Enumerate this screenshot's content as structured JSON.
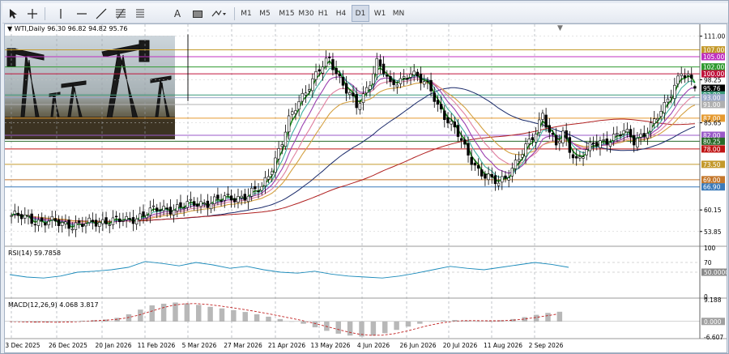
{
  "toolbar": {
    "tools": [
      {
        "name": "cursor-icon"
      },
      {
        "name": "crosshair-icon"
      },
      {
        "name": "vertical-line-icon"
      },
      {
        "name": "horizontal-line-icon"
      },
      {
        "name": "trendline-icon"
      },
      {
        "name": "fibonacci-icon"
      },
      {
        "name": "text-icon",
        "label": "A"
      },
      {
        "name": "text-label-icon",
        "label": "T"
      },
      {
        "name": "rectangle-icon"
      },
      {
        "name": "shapes-dropdown-icon"
      }
    ],
    "timeframes": [
      "M1",
      "M5",
      "M15",
      "M30",
      "H1",
      "H4",
      "D1",
      "W1",
      "MN"
    ],
    "active_timeframe": "D1"
  },
  "chart": {
    "symbol_info": "WTI,Daily  96.30 96.82 94.82 95.76",
    "price_labels": [
      {
        "text": "111.00",
        "value": 111.0,
        "bg": ""
      },
      {
        "text": "107.00",
        "value": 107.0,
        "bg": "#c49a2c"
      },
      {
        "text": "105.00",
        "value": 105.0,
        "bg": "#c030c0"
      },
      {
        "text": "102.00",
        "value": 102.0,
        "bg": "#2f9a2f"
      },
      {
        "text": "100.00",
        "value": 100.0,
        "bg": "#c0143c"
      },
      {
        "text": "98.25",
        "value": 98.25,
        "bg": ""
      },
      {
        "text": "95.76",
        "value": 95.76,
        "bg": "#000000"
      },
      {
        "text": "93.80",
        "value": 93.8,
        "bg": "#3a9a7a"
      },
      {
        "text": "93.00",
        "value": 93.0,
        "bg": "#9aa8c8"
      },
      {
        "text": "91.00",
        "value": 91.0,
        "bg": "#b0b0b0"
      },
      {
        "text": "87.00",
        "value": 87.0,
        "bg": "#e59a30"
      },
      {
        "text": "85.65",
        "value": 85.65,
        "bg": ""
      },
      {
        "text": "82.00",
        "value": 82.0,
        "bg": "#9a5ac8"
      },
      {
        "text": "80.25",
        "value": 80.25,
        "bg": "#2a6a2a"
      },
      {
        "text": "78.00",
        "value": 78.0,
        "bg": "#c01414"
      },
      {
        "text": "73.50",
        "value": 73.5,
        "bg": "#c49a2c"
      },
      {
        "text": "69.00",
        "value": 69.0,
        "bg": "#c4782c"
      },
      {
        "text": "66.90",
        "value": 66.9,
        "bg": "#3a7aba"
      },
      {
        "text": "60.15",
        "value": 60.15,
        "bg": ""
      },
      {
        "text": "53.85",
        "value": 53.85,
        "bg": ""
      }
    ],
    "date_labels": [
      "3 Dec 2025",
      "26 Dec 2025",
      "20 Jan 2026",
      "11 Feb 2026",
      "5 Mar 2026",
      "27 Mar 2026",
      "21 Apr 2026",
      "13 May 2026",
      "4 Jun 2026",
      "26 Jun 2026",
      "20 Jul 2026",
      "11 Aug 2026",
      "2 Sep 2026"
    ]
  },
  "rsi": {
    "label": "RSI(14) 59.7858",
    "levels": [
      {
        "text": "100",
        "value": 100
      },
      {
        "text": "70",
        "value": 70
      },
      {
        "text": "50.0000",
        "value": 50,
        "highlight": true
      },
      {
        "text": "0",
        "value": 0
      }
    ]
  },
  "macd": {
    "label": "MACD(12,26,9) 4.068 3.817",
    "levels": [
      {
        "text": "9.188",
        "value": 9.188
      },
      {
        "text": "0.000",
        "value": 0,
        "highlight": true
      },
      {
        "text": "-6.607",
        "value": -6.607
      }
    ]
  },
  "chart_data": {
    "type": "candlestick",
    "title": "WTI,Daily",
    "x_dates": [
      "3 Dec 2025",
      "26 Dec 2025",
      "20 Jan 2026",
      "11 Feb 2026",
      "5 Mar 2026",
      "27 Mar 2026",
      "21 Apr 2026",
      "13 May 2026",
      "4 Jun 2026",
      "26 Jun 2026",
      "20 Jul 2026",
      "11 Aug 2026",
      "2 Sep 2026"
    ],
    "ylim": [
      50,
      114
    ],
    "last": {
      "open": 96.3,
      "high": 96.82,
      "low": 94.82,
      "close": 95.76
    },
    "close_path": [
      [
        0,
        58.5
      ],
      [
        8,
        57
      ],
      [
        14,
        56.2
      ],
      [
        22,
        55.8
      ],
      [
        28,
        57.2
      ],
      [
        34,
        56.8
      ],
      [
        40,
        59.5
      ],
      [
        46,
        60.5
      ],
      [
        52,
        61.5
      ],
      [
        58,
        62.5
      ],
      [
        64,
        63.5
      ],
      [
        70,
        64.5
      ],
      [
        74,
        66.5
      ],
      [
        77,
        73
      ],
      [
        80,
        80
      ],
      [
        82,
        86
      ],
      [
        85,
        92
      ],
      [
        88,
        97
      ],
      [
        91,
        101
      ],
      [
        94,
        104
      ],
      [
        97,
        99
      ],
      [
        100,
        94
      ],
      [
        102,
        90
      ],
      [
        104,
        93
      ],
      [
        106,
        98
      ],
      [
        108,
        104
      ],
      [
        110,
        101
      ],
      [
        112,
        96
      ],
      [
        115,
        98
      ],
      [
        118,
        101
      ],
      [
        121,
        98
      ],
      [
        124,
        95
      ],
      [
        126,
        91
      ],
      [
        128,
        88
      ],
      [
        130,
        85
      ],
      [
        132,
        82
      ],
      [
        134,
        78
      ],
      [
        136,
        75
      ],
      [
        138,
        72
      ],
      [
        140,
        70
      ],
      [
        142,
        68.5
      ],
      [
        144,
        68
      ],
      [
        146,
        70
      ],
      [
        149,
        74
      ],
      [
        152,
        78
      ],
      [
        155,
        83
      ],
      [
        157,
        89
      ],
      [
        159,
        83
      ],
      [
        161,
        79
      ],
      [
        163,
        82
      ],
      [
        165,
        78
      ],
      [
        167,
        75
      ],
      [
        169,
        77
      ],
      [
        172,
        79
      ],
      [
        175,
        80
      ],
      [
        178,
        82
      ],
      [
        181,
        83
      ],
      [
        184,
        80
      ],
      [
        187,
        83
      ],
      [
        190,
        86
      ],
      [
        193,
        90
      ],
      [
        196,
        97
      ],
      [
        198,
        101
      ],
      [
        200,
        99
      ],
      [
        202,
        95.76
      ]
    ],
    "ema_series": [
      {
        "color": "#1a8a1a",
        "lag": 3
      },
      {
        "color": "#40b0a0",
        "lag": 6
      },
      {
        "color": "#9a40b0",
        "lag": 10
      },
      {
        "color": "#e080a0",
        "lag": 16
      },
      {
        "color": "#d4a040",
        "lag": 24
      }
    ],
    "sma_series": [
      {
        "color": "#1a2a6a",
        "lag": 50
      },
      {
        "color": "#b02020",
        "lag": 100
      }
    ],
    "rsi_series": [
      45,
      40,
      38,
      42,
      50,
      52,
      55,
      60,
      72,
      68,
      63,
      70,
      65,
      58,
      62,
      55,
      50,
      48,
      52,
      46,
      42,
      40,
      38,
      42,
      48,
      55,
      62,
      58,
      55,
      60,
      65,
      70,
      66,
      60
    ],
    "macd_hist": [
      0,
      -0.3,
      -0.5,
      -0.4,
      -0.2,
      0.1,
      0.3,
      0.5,
      0.8,
      1.5,
      3,
      5,
      6.8,
      7.5,
      8,
      7.6,
      7,
      6.2,
      5.5,
      4.8,
      4,
      3,
      2,
      1,
      0,
      -1,
      -2.5,
      -4,
      -5.2,
      -6,
      -6.4,
      -6,
      -5,
      -3.6,
      -2.2,
      -1,
      0,
      0.4,
      0.6,
      0.3,
      0,
      0.2,
      0.5,
      1,
      1.8,
      2.8,
      3.6,
      4.1
    ]
  }
}
